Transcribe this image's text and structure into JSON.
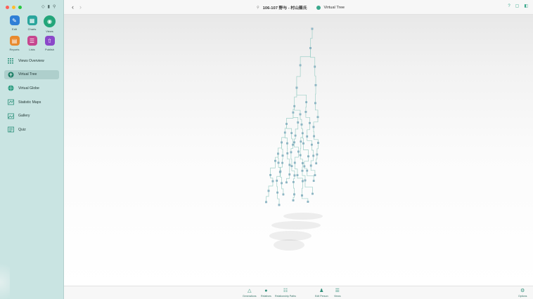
{
  "window": {
    "title": "106-107 野与 - 村山蕪氏",
    "view_name": "Virtual Tree",
    "colors": {
      "sidebar_bg": "#c9e4e2",
      "accent": "#3aa88c"
    }
  },
  "toolbar": {
    "back_icon": "chevron-left-icon",
    "forward_icon": "chevron-right-icon",
    "right_icons": [
      "help-icon",
      "window-icon",
      "sidebar-toggle-icon"
    ]
  },
  "sidebar": {
    "tools": [
      "tag-icon",
      "bookmark-icon",
      "search-icon"
    ],
    "apps": [
      {
        "label": "Edit",
        "icon": "pencil-icon",
        "color": "#2f7fd6"
      },
      {
        "label": "Charts",
        "icon": "charts-icon",
        "color": "#2aa59c"
      },
      {
        "label": "Views",
        "icon": "eye-icon",
        "color": "#22a57a"
      },
      {
        "label": "Reports",
        "icon": "reports-icon",
        "color": "#e88a2e"
      },
      {
        "label": "Lists",
        "icon": "lists-icon",
        "color": "#c6478f"
      },
      {
        "label": "Publish",
        "icon": "publish-icon",
        "color": "#8a48c9"
      }
    ],
    "items": [
      {
        "label": "Views Overview",
        "icon": "grid-icon",
        "selected": false
      },
      {
        "label": "Virtual Tree",
        "icon": "tree-icon",
        "selected": true
      },
      {
        "label": "Virtual Globe",
        "icon": "globe-icon",
        "selected": false
      },
      {
        "label": "Statistic Maps",
        "icon": "map-icon",
        "selected": false
      },
      {
        "label": "Gallery",
        "icon": "gallery-icon",
        "selected": false
      },
      {
        "label": "Quiz",
        "icon": "quiz-icon",
        "selected": false
      }
    ]
  },
  "bottombar": {
    "items": [
      {
        "label": "Generations",
        "icon": "generations-icon"
      },
      {
        "label": "Relatives",
        "icon": "relatives-icon"
      },
      {
        "label": "Relationship Paths",
        "icon": "relationship-paths-icon"
      },
      {
        "label": "Edit Person",
        "icon": "edit-person-icon"
      },
      {
        "label": "Views",
        "icon": "views-icon"
      },
      {
        "label": "Options",
        "icon": "options-icon"
      }
    ]
  }
}
